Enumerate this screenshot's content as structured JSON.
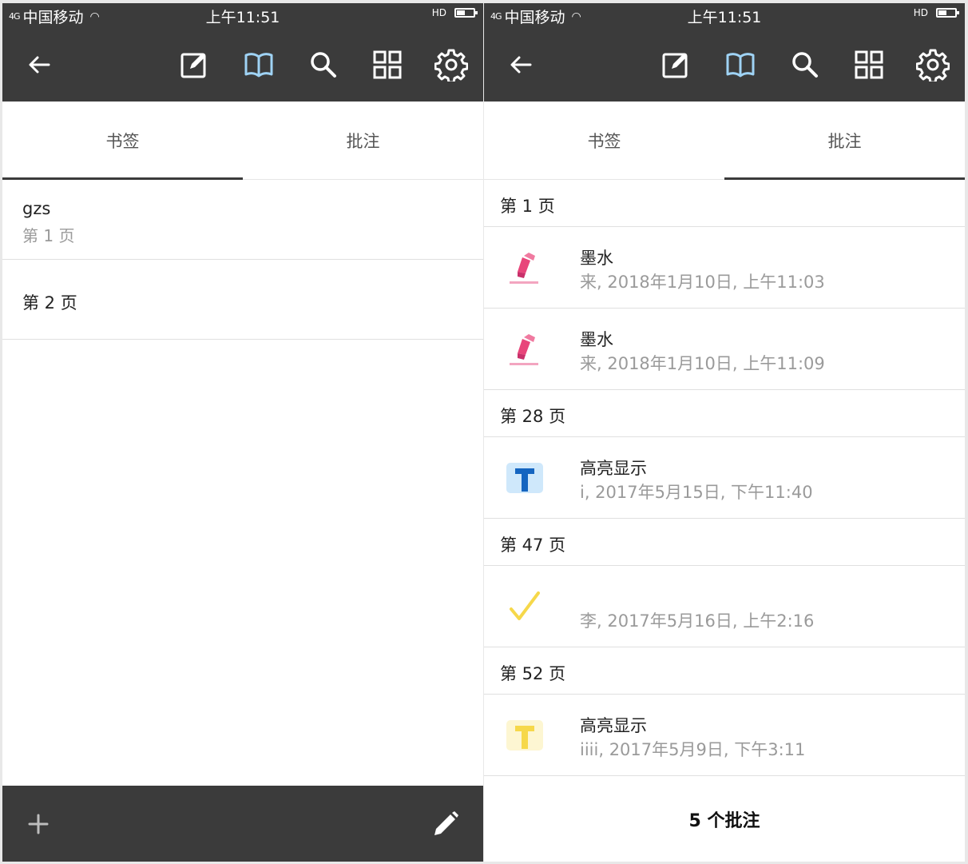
{
  "colors": {
    "bar_bg": "#3b3b3b",
    "icon_white": "#ffffff",
    "icon_active": "#9fd3f5",
    "ink_pink": "#e8457a",
    "highlight_blue": "#1565c0",
    "highlight_yellow": "#f6d84a",
    "check_yellow": "#f6d84a"
  },
  "status_bar": {
    "signal": "4G",
    "carrier": "中国移动",
    "time": "上午11:51",
    "call_indicator": "HD",
    "battery_level": 0.45
  },
  "toolbar_icons": [
    "back-arrow-icon",
    "edit-note-icon",
    "book-open-icon",
    "search-icon",
    "grid-icon",
    "gear-icon"
  ],
  "tabs": {
    "bookmarks": "书签",
    "annotations": "批注"
  },
  "bookmarks": [
    {
      "title": "gzs",
      "page": "第 1 页"
    },
    {
      "title": "第 2 页",
      "page": ""
    }
  ],
  "bottom_bar_icons": [
    "plus-icon",
    "pencil-icon"
  ],
  "annotation_groups": [
    {
      "page": "第 1 页",
      "items": [
        {
          "icon": "ink-marker-icon",
          "type": "墨水",
          "meta": "来, 2018年1月10日, 上午11:03"
        },
        {
          "icon": "ink-marker-icon",
          "type": "墨水",
          "meta": "来, 2018年1月10日, 上午11:09"
        }
      ]
    },
    {
      "page": "第 28 页",
      "items": [
        {
          "icon": "highlight-text-blue-icon",
          "type": "高亮显示",
          "meta": "i, 2017年5月15日, 下午11:40"
        }
      ]
    },
    {
      "page": "第 47 页",
      "items": [
        {
          "icon": "checkmark-icon",
          "type": "",
          "meta": "李, 2017年5月16日, 上午2:16"
        }
      ]
    },
    {
      "page": "第 52 页",
      "items": [
        {
          "icon": "highlight-text-yellow-icon",
          "type": "高亮显示",
          "meta": "iiii, 2017年5月9日, 下午3:11"
        }
      ]
    }
  ],
  "annotation_count_label": "5 个批注"
}
